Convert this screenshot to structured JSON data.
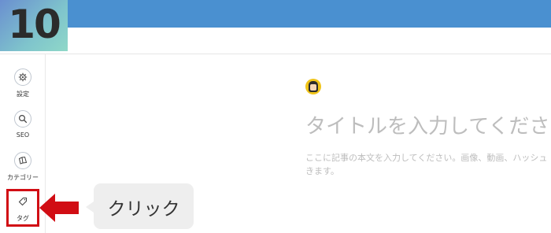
{
  "step": {
    "number": "10"
  },
  "sidebar": {
    "items": [
      {
        "label": "設定",
        "icon": "gear-icon"
      },
      {
        "label": "SEO",
        "icon": "search-icon"
      },
      {
        "label": "カテゴリー",
        "icon": "category-icon"
      },
      {
        "label": "タグ",
        "icon": "tag-icon"
      }
    ]
  },
  "callout": {
    "text": "クリック"
  },
  "editor": {
    "title_placeholder": "タイトルを入力してください",
    "body_placeholder_line1": "ここに記事の本文を入力してください。画像、動画、ハッシュ",
    "body_placeholder_line2": "きます。",
    "avatar": "user-avatar"
  },
  "colors": {
    "topbar": "#4a90d0",
    "highlight": "#d10d14",
    "placeholder_text": "#bdbdbd"
  }
}
